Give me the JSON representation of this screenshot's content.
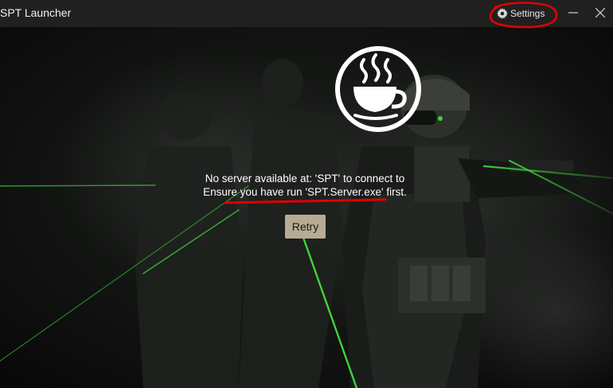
{
  "window": {
    "title": "SPT Launcher",
    "settings_label": "Settings",
    "minimize_icon": "minimize-icon",
    "close_icon": "close-icon"
  },
  "main": {
    "logo_icon": "coffee-cup-logo-icon",
    "message_line1": "No server available at: 'SPT' to connect to",
    "message_line2": "Ensure you have run 'SPT.Server.exe' first.",
    "retry_label": "Retry"
  },
  "colors": {
    "titlebar": "#202020",
    "retry_button": "#b8ab93",
    "annotation_red": "#e00000",
    "laser_green": "#3fd23a"
  }
}
